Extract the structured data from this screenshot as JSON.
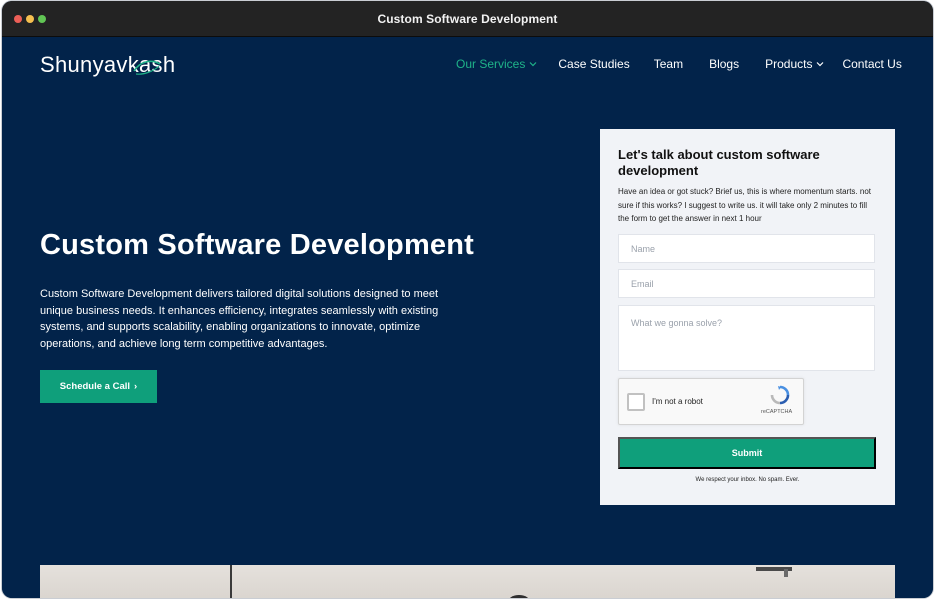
{
  "window": {
    "title": "Custom Software Development"
  },
  "brand": {
    "logo_text": "Shunyavkash",
    "accent_color": "#1fb389",
    "background_color": "#02234a",
    "button_color": "#0f9f7b"
  },
  "nav": {
    "items": [
      {
        "label": "Our Services",
        "active": true,
        "has_dropdown": true
      },
      {
        "label": "Case Studies",
        "active": false,
        "has_dropdown": false
      },
      {
        "label": "Team",
        "active": false,
        "has_dropdown": false
      },
      {
        "label": "Blogs",
        "active": false,
        "has_dropdown": false
      },
      {
        "label": "Products",
        "active": false,
        "has_dropdown": true
      },
      {
        "label": "Contact Us",
        "active": false,
        "has_dropdown": false
      }
    ]
  },
  "hero": {
    "title": "Custom Software Development",
    "description": "Custom Software Development delivers tailored digital solutions designed to meet unique business needs. It enhances efficiency, integrates seamlessly with existing systems, and supports scalability, enabling organizations to innovate, optimize operations, and achieve long term competitive advantages.",
    "cta_label": "Schedule a Call",
    "cta_icon": "chevron-right-icon"
  },
  "form": {
    "heading": "Let's talk about custom software development",
    "subtext": "Have an idea or got stuck? Brief us, this is where momentum starts. not sure if this works? I suggest to write us. it will take only 2 minutes to fill the form to get the answer in next 1 hour",
    "name_placeholder": "Name",
    "email_placeholder": "Email",
    "solve_placeholder": "What we gonna solve?",
    "captcha_label": "I'm not a robot",
    "captcha_brand": "reCAPTCHA",
    "submit_label": "Submit",
    "footer_note": "We respect your inbox. No spam. Ever."
  }
}
